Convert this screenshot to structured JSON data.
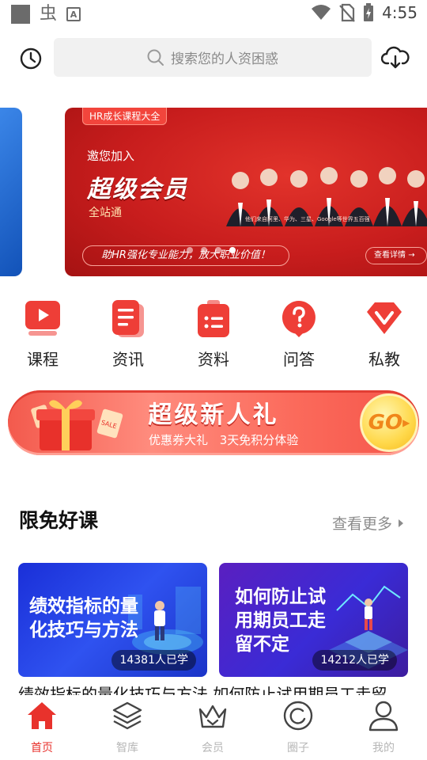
{
  "status_bar": {
    "app_glyph": "虫",
    "a_badge": "A",
    "time": "4:55"
  },
  "search": {
    "placeholder": "搜索您的人资困惑"
  },
  "banner": {
    "tag": "HR成长课程大全",
    "invite": "邀您加入",
    "title": "超级会员",
    "all_site": "全站通",
    "credits": "他们来自阿里、华为、三星、Google等世界五百强",
    "slogan": "助HR强化专业能力，放大职业价值！",
    "detail_button": "查看详情",
    "page_count": 4,
    "active_index": 3
  },
  "categories": [
    {
      "label": "课程",
      "icon": "play-video-icon"
    },
    {
      "label": "资讯",
      "icon": "news-document-icon"
    },
    {
      "label": "资料",
      "icon": "clipboard-list-icon"
    },
    {
      "label": "问答",
      "icon": "question-bubble-icon"
    },
    {
      "label": "私教",
      "icon": "private-tutor-icon"
    }
  ],
  "promo": {
    "title": "超级新人礼",
    "subtitle": "优惠券大礼 3天免积分体验",
    "go_label": "GO",
    "gift_tag": "SALE"
  },
  "section": {
    "title": "限免好课",
    "more_label": "查看更多"
  },
  "courses": [
    {
      "title": "绩效指标的量化技巧与方法",
      "learners": "14381人已学"
    },
    {
      "title": "如何防止试用期员工走留不定",
      "learners": "14212人已学"
    }
  ],
  "courses_caption": "绩效指标的量化技巧与方法 如何防止试用期员工走留",
  "bottom_nav": [
    {
      "label": "首页",
      "icon": "home-icon",
      "active": true
    },
    {
      "label": "智库",
      "icon": "layers-icon",
      "active": false
    },
    {
      "label": "会员",
      "icon": "crown-icon",
      "active": false
    },
    {
      "label": "圈子",
      "icon": "circle-icon",
      "active": false
    },
    {
      "label": "我的",
      "icon": "profile-icon",
      "active": false
    }
  ],
  "colors": {
    "accent": "#e8322c",
    "nav_inactive": "#b7b7b7",
    "search_bg": "#f1f1f1"
  }
}
